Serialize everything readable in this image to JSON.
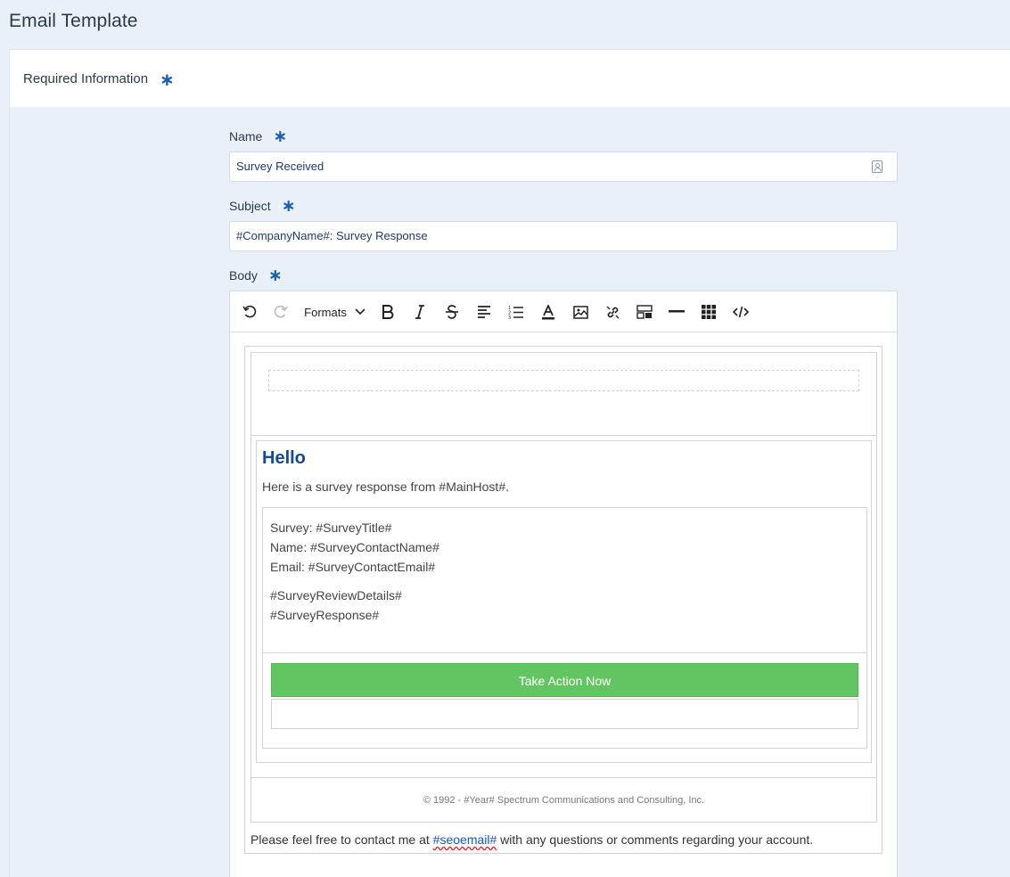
{
  "page": {
    "title": "Email Template"
  },
  "section": {
    "label": "Required Information",
    "required_mark": "∗"
  },
  "fields": {
    "name": {
      "label": "Name",
      "value": "Survey Received"
    },
    "subject": {
      "label": "Subject",
      "value": "#CompanyName#: Survey Response"
    },
    "body": {
      "label": "Body"
    }
  },
  "toolbar": {
    "formats_label": "Formats",
    "icons": [
      "undo-icon",
      "redo-icon",
      "chevron-down-icon",
      "bold-icon",
      "italic-icon",
      "strikethrough-icon",
      "align-left-icon",
      "numbered-list-icon",
      "text-color-icon",
      "image-icon",
      "link-icon",
      "template-icon",
      "horizontal-rule-icon",
      "table-icon",
      "source-code-icon"
    ]
  },
  "email": {
    "greeting": "Hello",
    "intro": "Here is a survey response from #MainHost#.",
    "details": {
      "survey": "Survey: #SurveyTitle#",
      "name": "Name: #SurveyContactName#",
      "email": "Email: #SurveyContactEmail#",
      "review": "#SurveyReviewDetails#",
      "response": "#SurveyResponse#"
    },
    "cta_label": "Take Action Now",
    "cta_color": "#63c462",
    "footer": "© 1992 - #Year# Spectrum Communications and Consulting, Inc.",
    "contact_prefix": "Please feel free to contact me at ",
    "contact_link": "#seoemail#",
    "contact_suffix": " with any questions or comments regarding your account."
  },
  "colors": {
    "accent": "#1f5fb0",
    "heading": "#114a9c",
    "page_bg": "#eaf0f7"
  }
}
